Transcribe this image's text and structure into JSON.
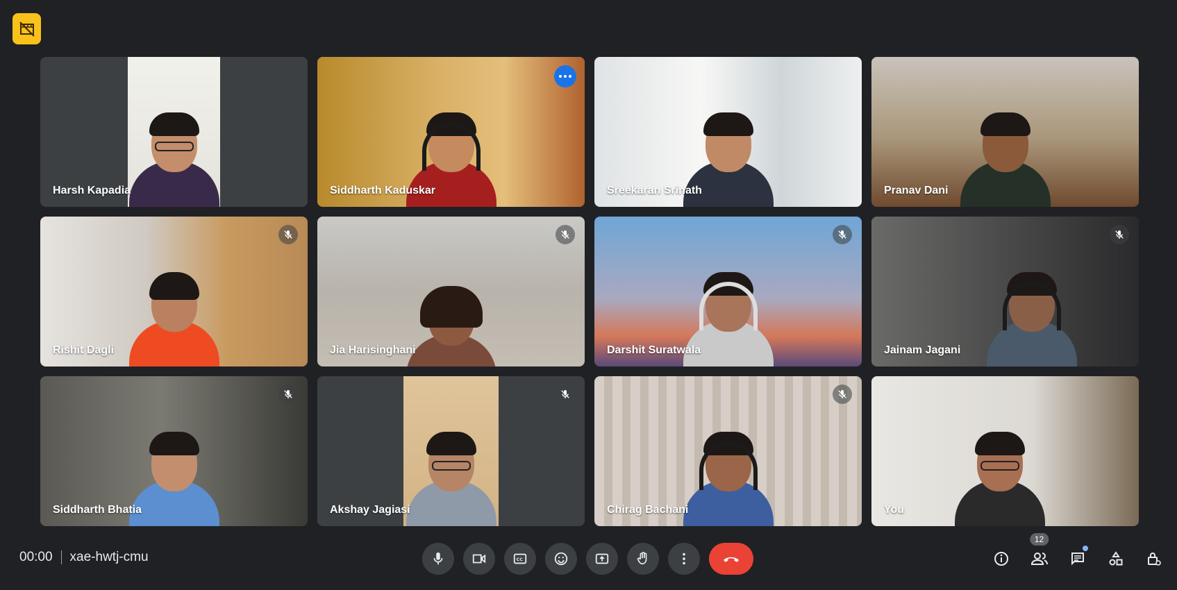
{
  "meeting": {
    "time": "00:00",
    "code": "xae-hwtj-cmu",
    "participant_count": "12"
  },
  "tiles": [
    {
      "name": "Harsh Kapadia",
      "muted": false,
      "active": false
    },
    {
      "name": "Siddharth Kaduskar",
      "muted": false,
      "active": true
    },
    {
      "name": "Sreekaran Srinath",
      "muted": false,
      "active": false
    },
    {
      "name": "Pranav Dani",
      "muted": false,
      "active": false
    },
    {
      "name": "Rishit Dagli",
      "muted": true,
      "active": false
    },
    {
      "name": "Jia Harisinghani",
      "muted": true,
      "active": false
    },
    {
      "name": "Darshit Suratwala",
      "muted": true,
      "active": false
    },
    {
      "name": "Jainam Jagani",
      "muted": true,
      "active": false
    },
    {
      "name": "Siddharth Bhatia",
      "muted": true,
      "active": false
    },
    {
      "name": "Akshay Jagiasi",
      "muted": true,
      "active": false
    },
    {
      "name": "Chirag Bachani",
      "muted": true,
      "active": false
    },
    {
      "name": "You",
      "muted": false,
      "active": false
    }
  ],
  "colors": {
    "background": "#202124",
    "accent": "#8ab4f8",
    "recording_badge": "#f9c21b",
    "hangup": "#ea4335"
  },
  "icons": {
    "recording": "recording-off-icon",
    "controls": [
      "mic-icon",
      "camera-icon",
      "captions-icon",
      "emoji-icon",
      "present-screen-icon",
      "raise-hand-icon",
      "more-options-icon",
      "hangup-icon"
    ],
    "right": [
      "info-icon",
      "people-icon",
      "chat-icon",
      "activities-icon",
      "host-controls-icon"
    ]
  }
}
